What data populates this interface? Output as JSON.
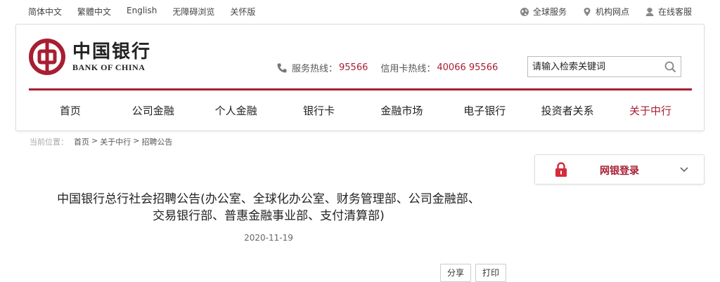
{
  "topbar": {
    "languages": [
      "简体中文",
      "繁體中文",
      "English",
      "无障碍浏览",
      "关怀版"
    ],
    "right_items": [
      {
        "label": "全球服务",
        "icon": "globe-icon"
      },
      {
        "label": "机构网点",
        "icon": "location-pin-icon"
      },
      {
        "label": "在线客服",
        "icon": "person-service-icon"
      }
    ]
  },
  "header": {
    "logo_cn": "中国银行",
    "logo_en": "BANK OF CHINA",
    "service_hotline_label": "服务热线：",
    "service_hotline_number": "95566",
    "credit_hotline_label": "信用卡热线：",
    "credit_hotline_number": "40066 95566",
    "search_placeholder": "请输入检索关键词"
  },
  "nav": {
    "items": [
      "首页",
      "公司金融",
      "个人金融",
      "银行卡",
      "金融市场",
      "电子银行",
      "投资者关系",
      "关于中行"
    ],
    "active_index": 7
  },
  "breadcrumb": {
    "prefix": "当前位置：",
    "items": [
      "首页",
      "关于中行",
      "招聘公告"
    ],
    "separator": ">"
  },
  "login": {
    "label": "网银登录"
  },
  "article": {
    "title_line1": "中国银行总行社会招聘公告(办公室、全球化办公室、财务管理部、公司金融部、",
    "title_line2": "交易银行部、普惠金融事业部、支付清算部)",
    "date": "2020-11-19",
    "share_label": "分享",
    "print_label": "打印"
  },
  "colors": {
    "brand_red": "#a71e32"
  }
}
